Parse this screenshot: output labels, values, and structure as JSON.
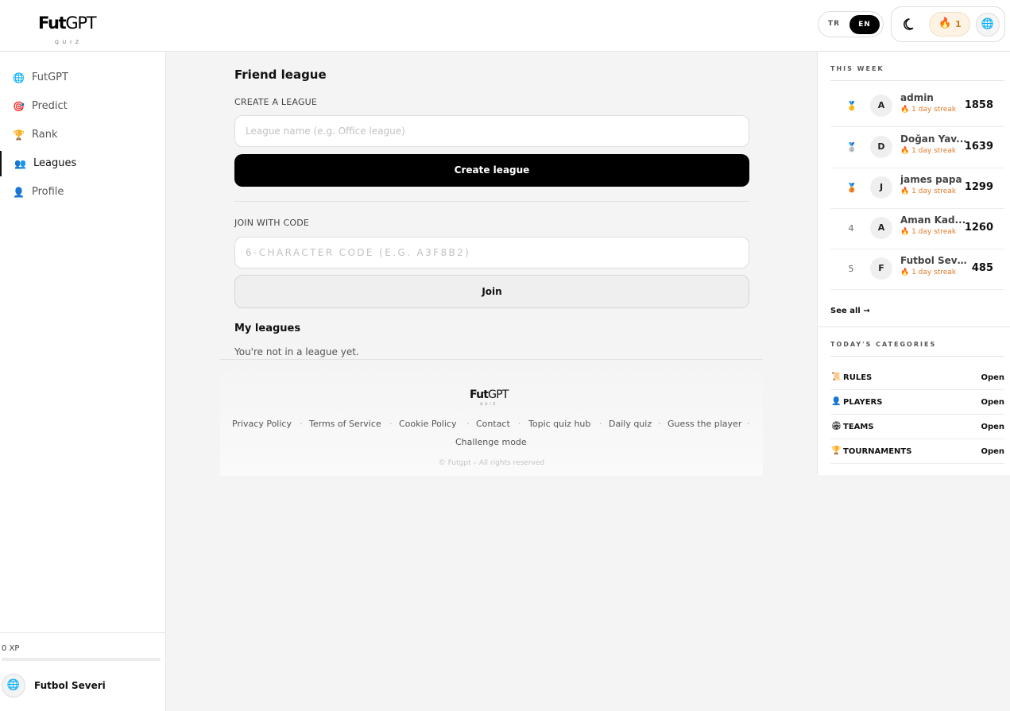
{
  "header": {
    "logo_bold": "Fut",
    "logo_regular": "GPT",
    "logo_sub": "QUIZ",
    "lang_tr": "TR",
    "lang_en": "EN",
    "streak_count": "1"
  },
  "sidebar": {
    "items": [
      {
        "label": "FutGPT",
        "icon": "🌐"
      },
      {
        "label": "Predict",
        "icon": "🎯"
      },
      {
        "label": "Rank",
        "icon": "🏆"
      },
      {
        "label": "Leagues",
        "icon": "👥"
      },
      {
        "label": "Profile",
        "icon": "👤"
      }
    ],
    "xp_label": "0 XP",
    "xp_progress": 0,
    "user_name": "Futbol Severi"
  },
  "main": {
    "title": "Friend league",
    "create_label": "CREATE A LEAGUE",
    "league_name_placeholder": "League name (e.g. Office league)",
    "create_button": "Create league",
    "join_label": "JOIN WITH CODE",
    "code_placeholder": "6-CHARACTER CODE (E.G. A3F8B2)",
    "join_button": "Join",
    "my_leagues_title": "My leagues",
    "empty_text": "You're not in a league yet."
  },
  "footer": {
    "logo_bold": "Fut",
    "logo_regular": "GPT",
    "logo_sub": "QUIZ",
    "links": [
      "Privacy Policy",
      "Terms of Service",
      "Cookie Policy",
      "Contact",
      "Topic quiz hub",
      "Daily quiz",
      "Guess the player",
      "Challenge mode"
    ],
    "separator": "·",
    "copyright": "© Futgpt – All rights reserved"
  },
  "right_panel": {
    "week_heading": "THIS WEEK",
    "leaderboard": [
      {
        "rank": "🥇",
        "initial": "A",
        "name": "admin",
        "streak": "1 day streak",
        "score": "1858"
      },
      {
        "rank": "🥈",
        "initial": "D",
        "name": "Doğan Yav...",
        "streak": "1 day streak",
        "score": "1639"
      },
      {
        "rank": "🥉",
        "initial": "J",
        "name": "james papa",
        "streak": "1 day streak",
        "score": "1299"
      },
      {
        "rank": "4",
        "initial": "A",
        "name": "Aman Kad...",
        "streak": "1 day streak",
        "score": "1260"
      },
      {
        "rank": "5",
        "initial": "F",
        "name": "Futbol Severi",
        "streak": "1 day streak",
        "score": "485"
      }
    ],
    "see_all": "See all →",
    "categories_heading": "TODAY'S CATEGORIES",
    "categories": [
      {
        "icon": "📜",
        "name": "RULES",
        "action": "Open"
      },
      {
        "icon": "👤",
        "name": "PLAYERS",
        "action": "Open"
      },
      {
        "icon": "🏟",
        "name": "TEAMS",
        "action": "Open"
      },
      {
        "icon": "🏆",
        "name": "TOURNAMENTS",
        "action": "Open"
      }
    ]
  }
}
